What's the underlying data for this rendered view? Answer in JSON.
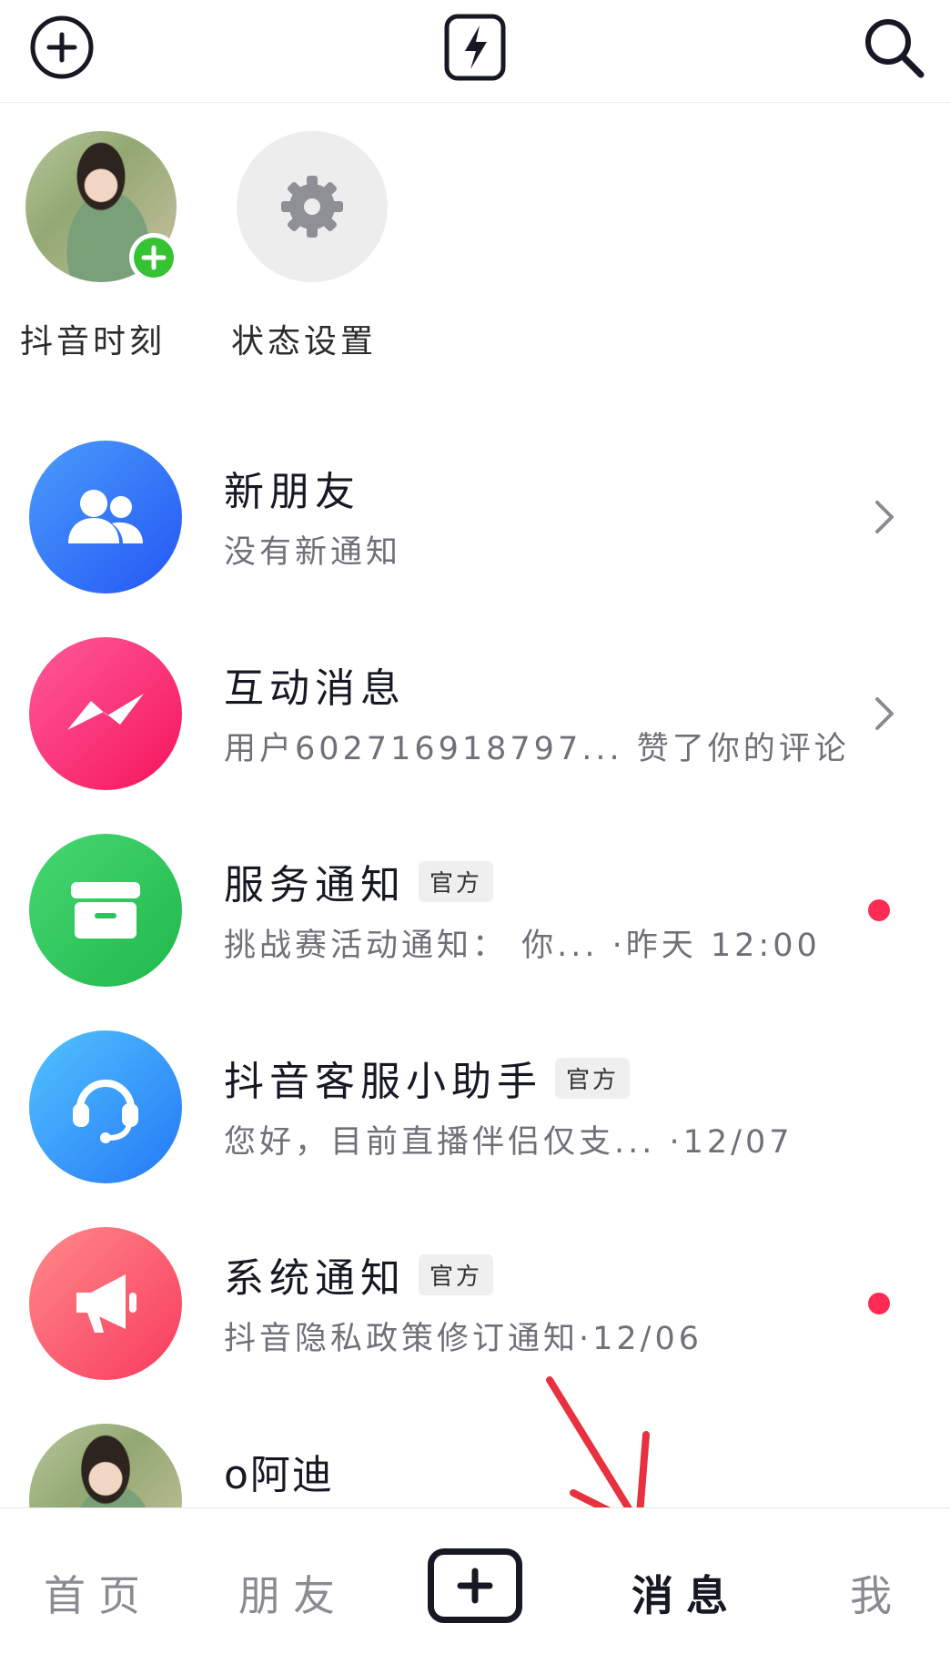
{
  "topbar": {
    "add_icon": "plus-circle-icon",
    "center_icon": "lightning-box-icon",
    "search_icon": "search-icon"
  },
  "stories": [
    {
      "label": "抖音时刻",
      "icon": "green-plus-icon"
    },
    {
      "label": "状态设置",
      "icon": "gear-icon"
    }
  ],
  "messages": [
    {
      "title": "新朋友",
      "subtitle": "没有新通知",
      "badge": "",
      "indicator": "chevron",
      "color": "#2f6bfa"
    },
    {
      "title": "互动消息",
      "subtitle": "用户602716918797... 赞了你的评论",
      "badge": "",
      "indicator": "chevron",
      "color": "#fe2c6b"
    },
    {
      "title": "服务通知",
      "subtitle": "挑战赛活动通知： 你... ·昨天 12:00",
      "badge": "官方",
      "indicator": "dot",
      "color": "#2cc45e"
    },
    {
      "title": "抖音客服小助手",
      "subtitle": "您好，目前直播伴侣仅支... ·12/07",
      "badge": "官方",
      "indicator": "none",
      "color": "#2a95fb"
    },
    {
      "title": "系统通知",
      "subtitle": "抖音隐私政策修订通知·12/06",
      "badge": "官方",
      "indicator": "dot",
      "color": "#fe4a62"
    },
    {
      "title": "o阿迪",
      "subtitle": "",
      "badge": "",
      "indicator": "none",
      "color": ""
    }
  ],
  "bottom_nav": {
    "home": "首页",
    "friends": "朋友",
    "create_icon": "plus-square-icon",
    "messages": "消息",
    "me": "我"
  },
  "annotation": {
    "arrow_color": "#e8313f"
  }
}
